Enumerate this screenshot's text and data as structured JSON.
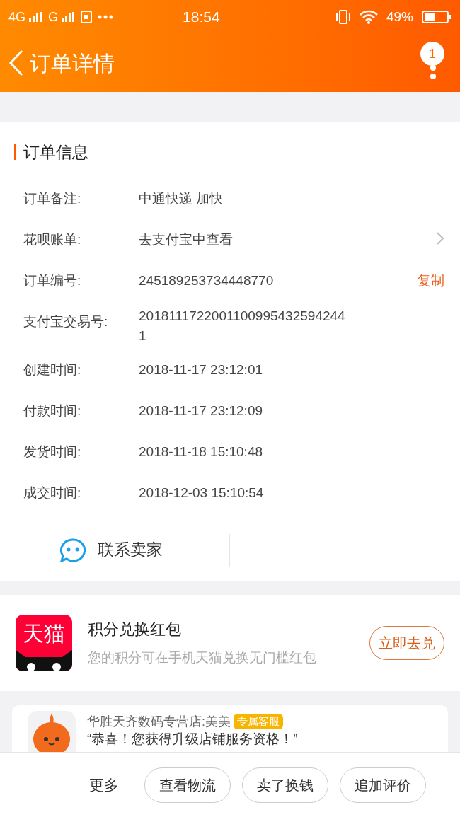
{
  "status_bar": {
    "left": [
      "4G",
      "G"
    ],
    "time": "18:54",
    "battery": "49%"
  },
  "header": {
    "back": "订单详情",
    "badge": "1"
  },
  "order_info": {
    "title": "订单信息",
    "rows": [
      {
        "kind": "text",
        "label": "订单备注:",
        "value": "中通快递  加快"
      },
      {
        "kind": "link",
        "label": "花呗账单:",
        "value": "去支付宝中查看"
      },
      {
        "kind": "copy",
        "label": "订单编号:",
        "value": "245189253734448770",
        "action": "复制"
      },
      {
        "kind": "text",
        "label": "支付宝交易号:",
        "value": "20181117220011009954325942441"
      },
      {
        "kind": "text",
        "label": "创建时间:",
        "value": "2018-11-17 23:12:01"
      },
      {
        "kind": "text",
        "label": "付款时间:",
        "value": "2018-11-17 23:12:09"
      },
      {
        "kind": "text",
        "label": "发货时间:",
        "value": "2018-11-18 15:10:48"
      },
      {
        "kind": "text",
        "label": "成交时间:",
        "value": "2018-12-03 15:10:54"
      }
    ],
    "contact": "联系卖家"
  },
  "promo": {
    "logo": "天猫",
    "title": "积分兑换红包",
    "subtitle": "您的积分可在手机天猫兑换无门槛红包",
    "button": "立即去兑"
  },
  "chat": {
    "sender": "华胜天齐数码专营店:美美",
    "tag": "专属客服",
    "message": "“恭喜！您获得升级店铺服务资格！”"
  },
  "bottom_bar": {
    "more": "更多",
    "buttons": [
      "查看物流",
      "卖了换钱",
      "追加评价"
    ]
  }
}
